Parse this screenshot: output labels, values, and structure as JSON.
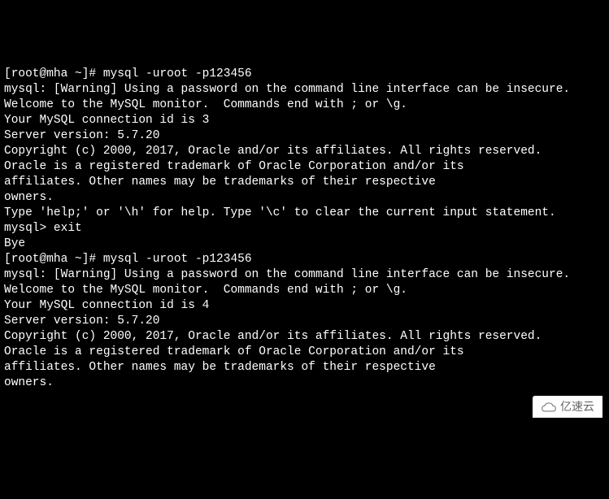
{
  "terminal": {
    "lines": [
      "[root@mha ~]# mysql -uroot -p123456",
      "mysql: [Warning] Using a password on the command line interface can be insecure.",
      "Welcome to the MySQL monitor.  Commands end with ; or \\g.",
      "Your MySQL connection id is 3",
      "Server version: 5.7.20",
      "",
      "Copyright (c) 2000, 2017, Oracle and/or its affiliates. All rights reserved.",
      "",
      "Oracle is a registered trademark of Oracle Corporation and/or its",
      "affiliates. Other names may be trademarks of their respective",
      "owners.",
      "",
      "Type 'help;' or '\\h' for help. Type '\\c' to clear the current input statement.",
      "",
      "mysql> exit",
      "Bye",
      "[root@mha ~]# mysql -uroot -p123456",
      "mysql: [Warning] Using a password on the command line interface can be insecure.",
      "Welcome to the MySQL monitor.  Commands end with ; or \\g.",
      "Your MySQL connection id is 4",
      "Server version: 5.7.20",
      "",
      "Copyright (c) 2000, 2017, Oracle and/or its affiliates. All rights reserved.",
      "",
      "Oracle is a registered trademark of Oracle Corporation and/or its",
      "affiliates. Other names may be trademarks of their respective",
      "owners."
    ]
  },
  "watermark": {
    "text": "亿速云"
  }
}
